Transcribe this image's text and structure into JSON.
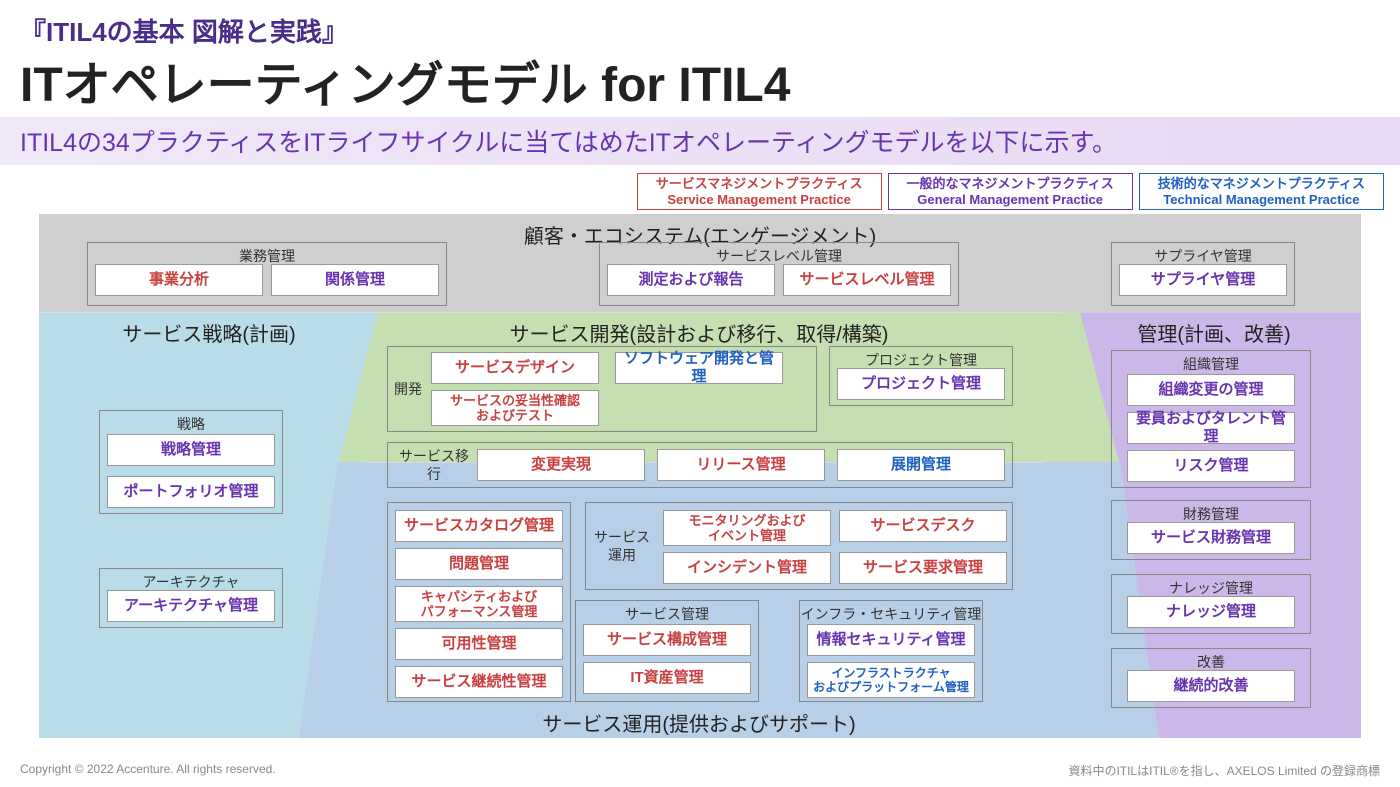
{
  "header": {
    "subtitle": "『ITIL4の基本 図解と実践』",
    "title": "ITオペレーティングモデル for ITIL4",
    "desc": "ITIL4の34プラクティスをITライフサイクルに当てはめたITオペレーティングモデルを以下に示す。"
  },
  "legend": {
    "red_jp": "サービスマネジメントプラクティス",
    "red_en": "Service Management Practice",
    "purple_jp": "一般的なマネジメントプラクティス",
    "purple_en": "General Management Practice",
    "blue_jp": "技術的なマネジメントプラクティス",
    "blue_en": "Technical Management Practice"
  },
  "sections": {
    "top": "顧客・エコシステム(エンゲージメント)",
    "strategy": "サービス戦略(計画)",
    "dev": "サービス開発(設計および移行、取得/構築)",
    "ops": "サービス運用(提供およびサポート)",
    "mgmt": "管理(計画、改善)"
  },
  "groups": {
    "business": "業務管理",
    "sla": "サービスレベル管理",
    "supplier": "サプライヤ管理",
    "strategy": "戦略",
    "arch": "アーキテクチャ",
    "dev": "開発",
    "transition": "サービス移行",
    "project": "プロジェクト管理",
    "svc_ops": "サービス\n運用",
    "svc_mgmt": "サービス管理",
    "infra": "インフラ・セキュリティ管理",
    "org": "組織管理",
    "finance": "財務管理",
    "knowledge": "ナレッジ管理",
    "improve": "改善"
  },
  "practices": {
    "business_analysis": "事業分析",
    "relationship": "関係管理",
    "measure": "測定および報告",
    "service_level": "サービスレベル管理",
    "supplier": "サプライヤ管理",
    "strategy_mgmt": "戦略管理",
    "portfolio": "ポートフォリオ管理",
    "architecture": "アーキテクチャ管理",
    "service_design": "サービスデザイン",
    "sw_dev": "ソフトウェア開発と管理",
    "validation": "サービスの妥当性確認\nおよびテスト",
    "project": "プロジェクト管理",
    "change": "変更実現",
    "release": "リリース管理",
    "deploy": "展開管理",
    "catalog": "サービスカタログ管理",
    "problem": "問題管理",
    "capacity": "キャパシティおよび\nパフォーマンス管理",
    "availability": "可用性管理",
    "continuity": "サービス継続性管理",
    "monitoring": "モニタリングおよび\nイベント管理",
    "service_desk": "サービスデスク",
    "incident": "インシデント管理",
    "service_request": "サービス要求管理",
    "config": "サービス構成管理",
    "it_asset": "IT資産管理",
    "info_sec": "情報セキュリティ管理",
    "infra_platform": "インフラストラクチャ\nおよびプラットフォーム管理",
    "org_change": "組織変更の管理",
    "talent": "要員およびタレント管理",
    "risk": "リスク管理",
    "service_finance": "サービス財務管理",
    "knowledge": "ナレッジ管理",
    "continual": "継続的改善"
  },
  "footer": {
    "copyright": "Copyright © 2022 Accenture. All rights reserved.",
    "trademark": "資料中のITILはITIL®を指し、AXELOS Limited の登録商標"
  }
}
